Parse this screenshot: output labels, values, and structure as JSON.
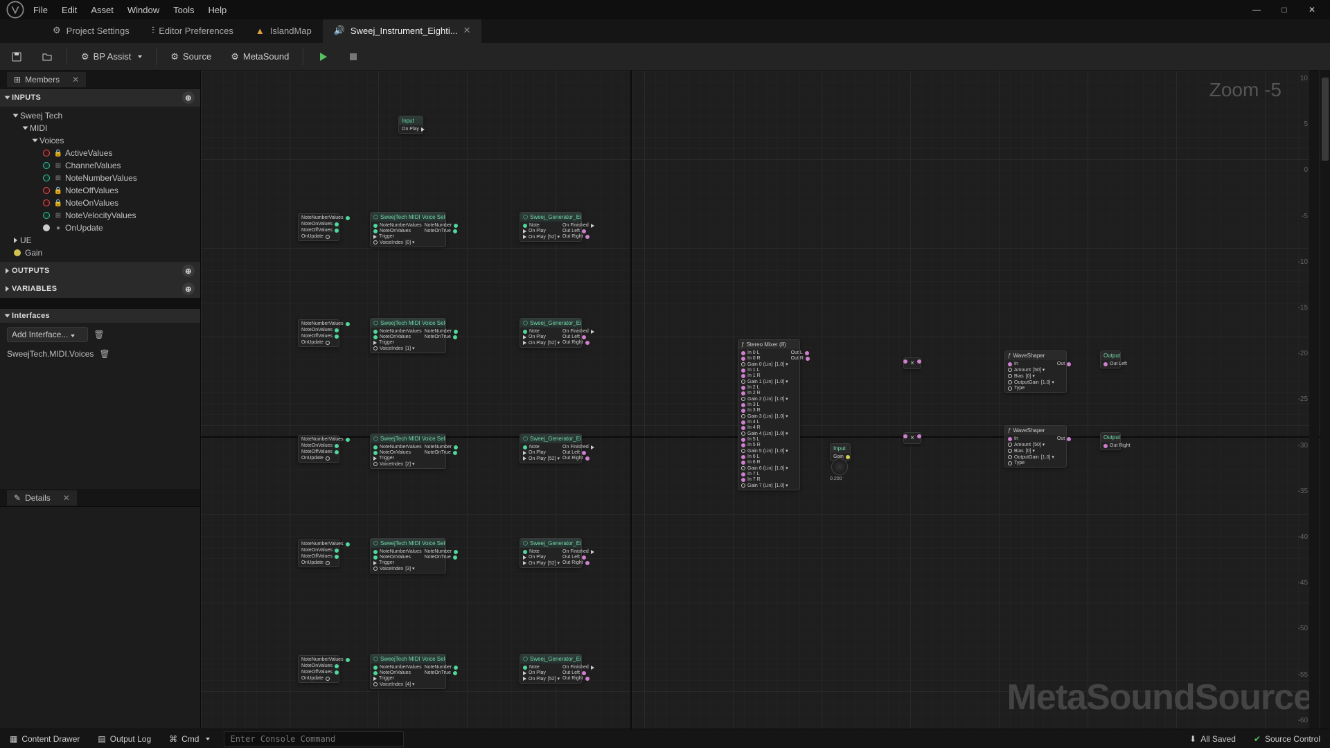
{
  "menu": {
    "file": "File",
    "edit": "Edit",
    "asset": "Asset",
    "window": "Window",
    "tools": "Tools",
    "help": "Help"
  },
  "wincontrols": {
    "min": "—",
    "max": "□",
    "close": "✕"
  },
  "tabs": [
    {
      "icon": "settings",
      "label": "Project Settings"
    },
    {
      "icon": "sliders",
      "label": "Editor Preferences"
    },
    {
      "icon": "map",
      "label": "IslandMap"
    },
    {
      "icon": "sound",
      "label": "Sweej_Instrument_Eighti...",
      "closeable": true,
      "active": true
    }
  ],
  "toolbar": {
    "save": "",
    "browse": "",
    "bpassist": "BP Assist",
    "source": "Source",
    "metasound": "MetaSound"
  },
  "members": {
    "tablabel": "Members",
    "inputs": "INPUTS",
    "tree": {
      "root": "Sweej Tech",
      "midi": "MIDI",
      "voices": "Voices",
      "items": [
        {
          "icon": "lock",
          "label": "ActiveValues"
        },
        {
          "icon": "grid",
          "label": "ChannelValues"
        },
        {
          "icon": "grid",
          "label": "NoteNumberValues"
        },
        {
          "icon": "lock",
          "label": "NoteOffValues"
        },
        {
          "icon": "lock",
          "label": "NoteOnValues"
        },
        {
          "icon": "grid",
          "label": "NoteVelocityValues"
        },
        {
          "icon": "dot",
          "label": "OnUpdate"
        }
      ],
      "ue": "UE",
      "gain": "Gain"
    },
    "outputs": "OUTPUTS",
    "variables": "VARIABLES"
  },
  "interfaces": {
    "title": "Interfaces",
    "add": "Add Interface...",
    "item": "SweejTech.MIDI.Voices"
  },
  "details": {
    "tablabel": "Details"
  },
  "graph": {
    "zoom": "Zoom -5",
    "watermark": "MetaSoundSource",
    "ruler": [
      "10",
      "5",
      "0",
      "-5",
      "-10",
      "-15",
      "-20",
      "-25",
      "-30",
      "-35",
      "-40",
      "-45",
      "-50",
      "-55",
      "-60"
    ],
    "nodes": {
      "input": {
        "title": "Input",
        "row": "On Play"
      },
      "pins": {
        "nn": "NoteNumberValues",
        "non": "NoteOnValues",
        "noff": "NoteOffValues",
        "onup": "OnUpdate"
      },
      "voice": {
        "title": "SweejTech MIDI Voice Select Single",
        "in1": "NoteNumberValues",
        "in2": "NoteOnValues",
        "in3": "Trigger",
        "in4": "VoiceIndex",
        "out1": "NoteNumber",
        "out2": "NoteOnTrue",
        "v": [
          "[0] ▾",
          "[1] ▾",
          "[2] ▾",
          "[3] ▾",
          "[4] ▾"
        ]
      },
      "gen": {
        "title": "Sweej_Generator_Eighties_MIDI",
        "i1": "Note",
        "i2": "On Play",
        "i3": "On Play",
        "o1": "On Finished",
        "o2": "Out Left",
        "o3": "Out Right",
        "vals": [
          "[52] ▾",
          "[52] ▾",
          "[52] ▾",
          "[52] ▾",
          "[52] ▾"
        ]
      },
      "mixer": {
        "title": "Stereo Mixer (8)",
        "pins": [
          "In 0 L",
          "In 0 R",
          "Gain 0 (Lin)",
          "In 1 L",
          "In 1 R",
          "Gain 1 (Lin)",
          "In 2 L",
          "In 2 R",
          "Gain 2 (Lin)",
          "In 3 L",
          "In 3 R",
          "Gain 3 (Lin)",
          "In 4 L",
          "In 4 R",
          "Gain 4 (Lin)",
          "In 5 L",
          "In 5 R",
          "Gain 5 (Lin)",
          "In 6 L",
          "In 6 R",
          "Gain 6 (Lin)",
          "In 7 L",
          "In 7 R",
          "Gain 7 (Lin)"
        ],
        "gv": "[1.0] ▾",
        "outs": [
          "Out L",
          "Out R"
        ]
      },
      "gain": {
        "title": "Input",
        "l": "Gain",
        "v": "0.200"
      },
      "mult": "×",
      "shaper": {
        "title": "WaveShaper",
        "i1": "In",
        "i2": "Amount",
        "i3": "Bias",
        "i4": "OutputGain",
        "i5": "Type",
        "v1": "[50] ▾",
        "v2": "[0] ▾",
        "v3": "[1.0] ▾",
        "o": "Out"
      },
      "output": {
        "title": "Output",
        "l1": "Out Left",
        "l2": "Out Right"
      }
    }
  },
  "status": {
    "drawer": "Content Drawer",
    "log": "Output Log",
    "cmd": "Cmd",
    "console": "Enter Console Command",
    "saved": "All Saved",
    "src": "Source Control"
  }
}
